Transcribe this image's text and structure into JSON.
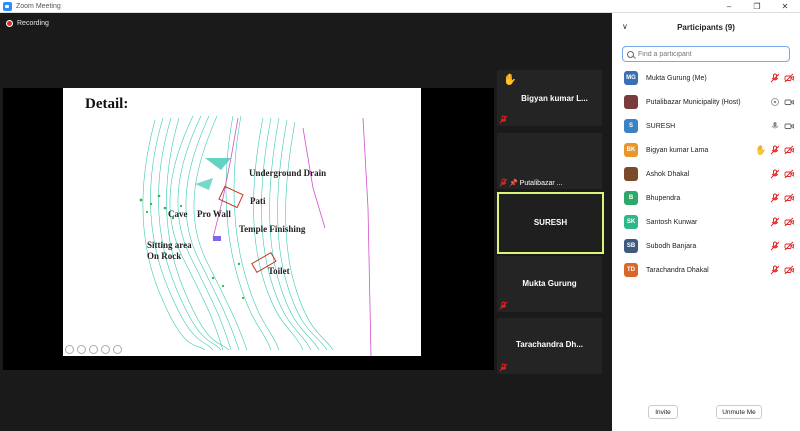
{
  "window": {
    "title": "Zoom Meeting"
  },
  "recording": {
    "label": "Recording"
  },
  "slide": {
    "title": "Detail:",
    "labels": {
      "underground_drain": "Underground Drain",
      "pati": "Pati",
      "cave": "Cave",
      "pro_wall": "Pro Wall",
      "temple_finishing": "Temple Finishing",
      "sitting_area": "Sitting area",
      "on_rock": "On Rock",
      "toilet": "Toilet"
    }
  },
  "tiles": [
    {
      "name": "Bigyan kumar L...",
      "hand_raised": true,
      "muted": true
    },
    {
      "name": "Putalibazar ...",
      "pinned": true,
      "muted": true
    },
    {
      "name": "SURESH",
      "active_speaker": true
    },
    {
      "name": "Mukta Gurung",
      "muted": true
    },
    {
      "name": "Tarachandra  Dh...",
      "muted": true
    }
  ],
  "participants_panel": {
    "title": "Participants (9)",
    "search_placeholder": "Find a participant",
    "participants": [
      {
        "initials": "MG",
        "name": "Mukta Gurung (Me)",
        "color": "#3a6fb5",
        "mic": "muted",
        "video": "none"
      },
      {
        "initials": "",
        "name": "Putalibazar Municipality (Host)",
        "color": "#7a3b3b",
        "mic": "off",
        "video": "on"
      },
      {
        "initials": "S",
        "name": "SURESH",
        "color": "#3b83c4",
        "mic": "on",
        "video": "on"
      },
      {
        "initials": "BK",
        "name": "Bigyan kumar Lama",
        "color": "#e8962e",
        "mic": "muted",
        "video": "off",
        "hand": true
      },
      {
        "initials": "",
        "name": "Ashok Dhakal",
        "color": "#7a4a2a",
        "mic": "muted",
        "video": "off"
      },
      {
        "initials": "B",
        "name": "Bhupendra",
        "color": "#2ea86a",
        "mic": "muted",
        "video": "off"
      },
      {
        "initials": "SK",
        "name": "Santosh Kunwar",
        "color": "#2eb88a",
        "mic": "muted",
        "video": "off"
      },
      {
        "initials": "SB",
        "name": "Subodh Banjara",
        "color": "#3f5a80",
        "mic": "muted",
        "video": "off"
      },
      {
        "initials": "TD",
        "name": "Tarachandra Dhakal",
        "color": "#d9662a",
        "mic": "muted",
        "video": "off"
      }
    ],
    "invite_label": "Invite",
    "unmute_label": "Unmute Me"
  },
  "colors": {
    "muted_red": "#e02828",
    "active_border": "#d9f57a",
    "accent": "#2d8cff",
    "hand": "#f3b51d"
  }
}
